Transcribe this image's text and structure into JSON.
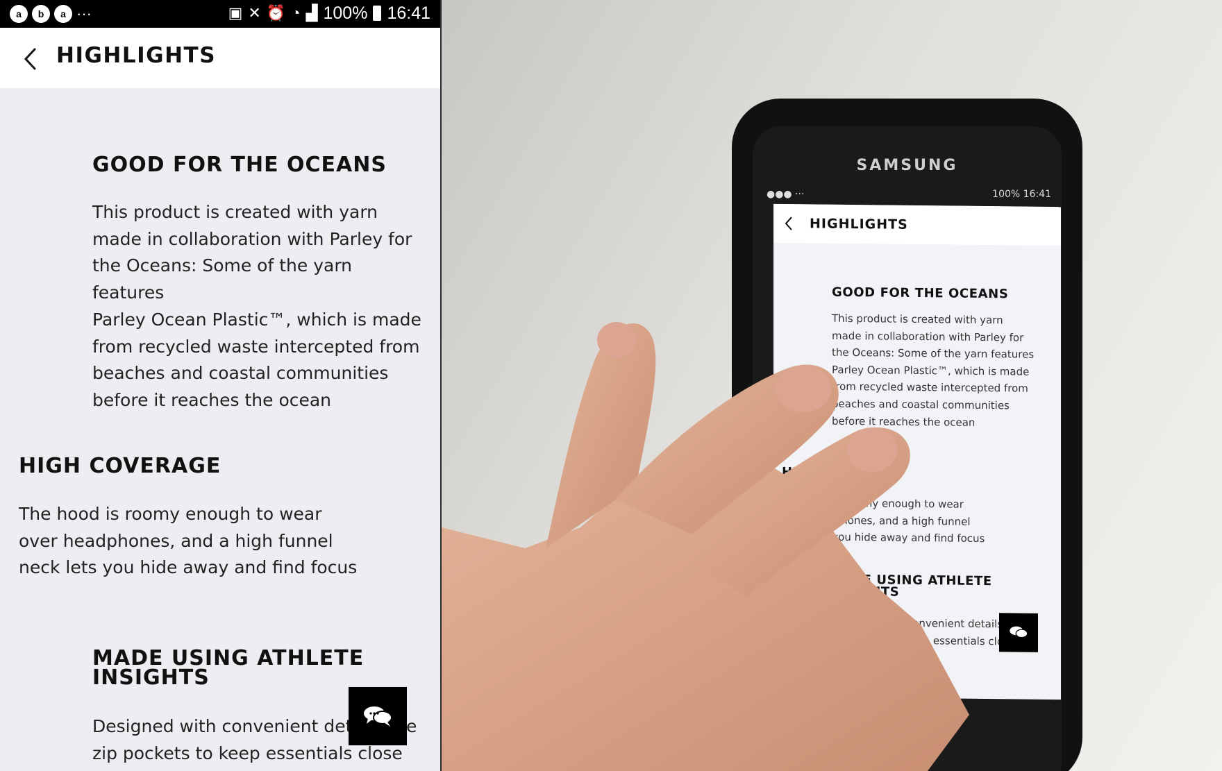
{
  "status_bar": {
    "notification_icons": [
      "a",
      "b",
      "a"
    ],
    "more": "···",
    "battery": "100%",
    "time": "16:41"
  },
  "app_bar": {
    "title": "HIGHLIGHTS"
  },
  "sections": [
    {
      "heading": "GOOD FOR THE OCEANS",
      "body": "This product is created with yarn\nmade in collaboration with Parley for\nthe Oceans: Some of the yarn features\nParley Ocean Plastic™, which is made\nfrom recycled waste intercepted from\nbeaches and coastal communities\nbefore it reaches the ocean"
    },
    {
      "heading": "HIGH COVERAGE",
      "body": "The hood is roomy enough to wear\nover headphones, and a high funnel\nneck lets you hide away and find focus"
    },
    {
      "heading": "MADE USING ATHLETE INSIGHTS",
      "body": "Designed with convenient details like\nzip pockets to keep essentials close"
    }
  ],
  "camera_view": {
    "phone_brand": "SAMSUNG",
    "mini_status_left": "●●● ···",
    "mini_status_right": "100% 16:41"
  },
  "colors": {
    "screen_bg": "#eceef1",
    "status_bar_bg": "#000000",
    "chat_button_bg": "#000000"
  },
  "icons": {
    "back": "chevron-left-icon",
    "chat": "chat-bubbles-icon"
  }
}
